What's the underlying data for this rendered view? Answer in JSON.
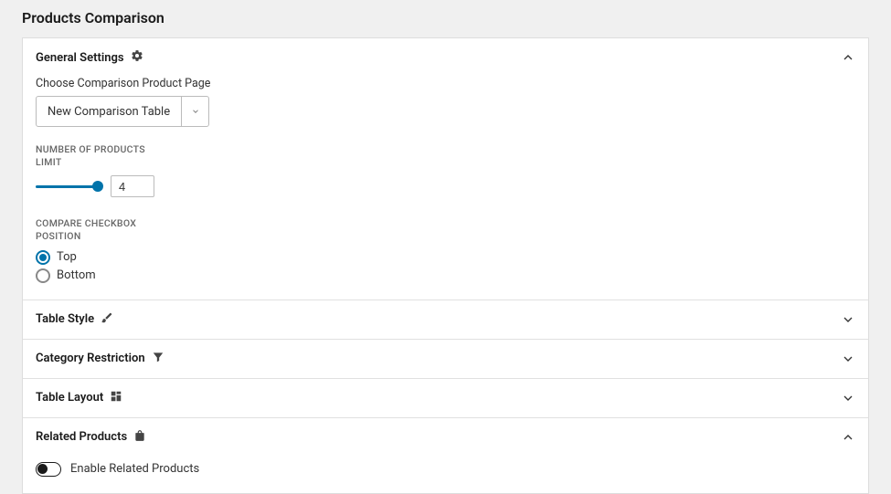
{
  "page_title": "Products Comparison",
  "sections": {
    "general": {
      "title": "General Settings",
      "expanded": true,
      "product_page": {
        "label": "Choose Comparison Product Page",
        "selected": "New Comparison Table"
      },
      "products_limit": {
        "label": "NUMBER OF PRODUCTS LIMIT",
        "value": "4"
      },
      "checkbox_position": {
        "label": "COMPARE CHECKBOX POSITION",
        "options": {
          "top": "Top",
          "bottom": "Bottom"
        },
        "selected": "top"
      }
    },
    "table_style": {
      "title": "Table Style",
      "expanded": false
    },
    "category_restriction": {
      "title": "Category Restriction",
      "expanded": false
    },
    "table_layout": {
      "title": "Table Layout",
      "expanded": false
    },
    "related_products": {
      "title": "Related Products",
      "expanded": true,
      "enable_label": "Enable Related Products",
      "enabled": false
    }
  }
}
